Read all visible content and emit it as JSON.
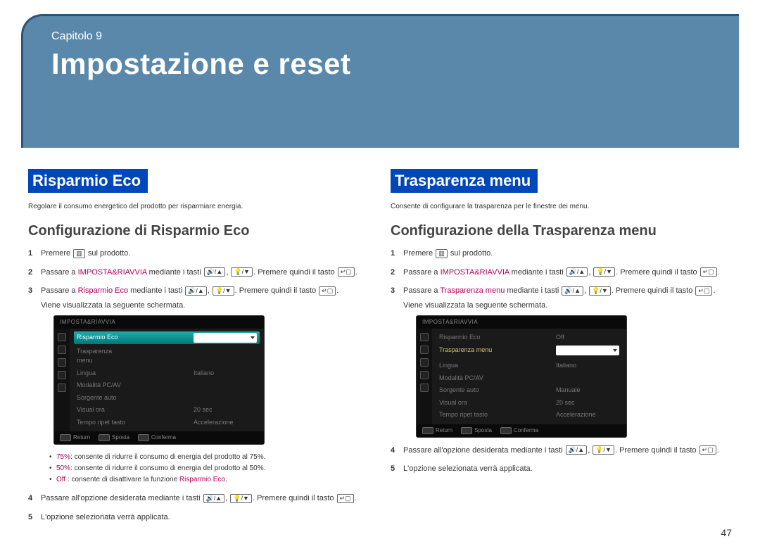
{
  "header": {
    "chapter_label": "Capitolo 9",
    "title": "Impostazione e reset"
  },
  "left": {
    "section_title": "Risparmio Eco",
    "description": "Regolare il consumo energetico del prodotto per risparmiare energia.",
    "subsection": "Configurazione di Risparmio Eco",
    "step1_a": "Premere ",
    "step1_b": " sul prodotto.",
    "step2_a": "Passare a ",
    "step2_link": "IMPOSTA&RIAVVIA",
    "step2_b": " mediante i tasti ",
    "step2_c": ". Premere quindi il tasto ",
    "step3_a": "Passare a ",
    "step3_link": "Risparmio Eco",
    "step3_b": " mediante i tasti ",
    "step3_c": ". Premere quindi il tasto ",
    "step3_d": "Viene visualizzata la seguente schermata.",
    "bullet1_a": "75%",
    "bullet1_b": ": consente di ridurre il consumo di energia del prodotto al 75%.",
    "bullet2_a": "50%",
    "bullet2_b": ": consente di ridurre il consumo di energia del prodotto al 50%.",
    "bullet3_a": "Off",
    "bullet3_b": " : consente di disattivare la funzione ",
    "bullet3_c": "Risparmio Eco",
    "step4_a": "Passare all'opzione desiderata mediante i tasti ",
    "step4_b": ". Premere quindi il tasto ",
    "step5": "L'opzione selezionata verrà applicata.",
    "osd": {
      "title": "IMPOSTA&RIAVVIA",
      "rows": [
        {
          "label": "Risparmio Eco",
          "value": ""
        },
        {
          "label": "Trasparenza menu",
          "value": ""
        },
        {
          "label": "Lingua",
          "value": "Italiano"
        },
        {
          "label": "Modalità PC/AV",
          "value": ""
        },
        {
          "label": "Sorgente auto",
          "value": ""
        },
        {
          "label": "Visual ora",
          "value": "20 sec"
        },
        {
          "label": "Tempo ripet tasto",
          "value": "Accelerazione"
        }
      ],
      "footer": {
        "return": "Return",
        "sposta": "Sposta",
        "conferma": "Conferma"
      }
    }
  },
  "right": {
    "section_title": "Trasparenza menu",
    "description": "Consente di configurare la trasparenza per le finestre dei menu.",
    "subsection": "Configurazione della Trasparenza menu",
    "step1_a": "Premere ",
    "step1_b": " sul prodotto.",
    "step2_a": "Passare a ",
    "step2_link": "IMPOSTA&RIAVVIA",
    "step2_b": " mediante i tasti ",
    "step2_c": ". Premere quindi il tasto ",
    "step3_a": "Passare a ",
    "step3_link": "Trasparenza menu",
    "step3_b": " mediante i tasti ",
    "step3_c": ". Premere quindi il tasto ",
    "step3_d": "Viene visualizzata la seguente schermata.",
    "step4_a": "Passare all'opzione desiderata mediante i tasti ",
    "step4_b": ". Premere quindi il tasto ",
    "step5": "L'opzione selezionata verrà applicata.",
    "osd": {
      "title": "IMPOSTA&RIAVVIA",
      "rows": [
        {
          "label": "Risparmio Eco",
          "value": "Off"
        },
        {
          "label": "Trasparenza menu",
          "value": ""
        },
        {
          "label": "Lingua",
          "value": "Italiano"
        },
        {
          "label": "Modalità PC/AV",
          "value": ""
        },
        {
          "label": "Sorgente auto",
          "value": "Manuale"
        },
        {
          "label": "Visual ora",
          "value": "20 sec"
        },
        {
          "label": "Tempo ripet tasto",
          "value": "Accelerazione"
        }
      ],
      "footer": {
        "return": "Return",
        "sposta": "Sposta",
        "conferma": "Conferma"
      }
    }
  },
  "page_number": "47"
}
